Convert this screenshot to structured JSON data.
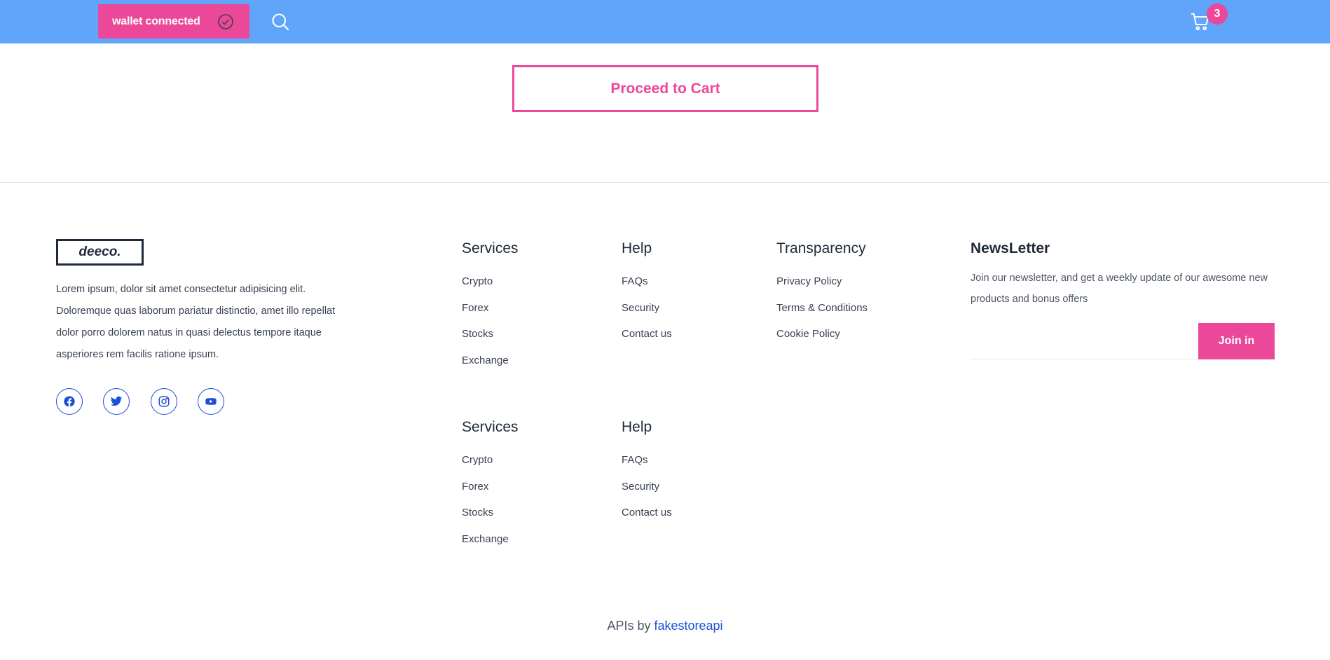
{
  "header": {
    "wallet_label": "wallet connected",
    "cart_count": "3"
  },
  "main": {
    "proceed_label": "Proceed to Cart"
  },
  "footer": {
    "logo_text": "deeco.",
    "about": "Lorem ipsum, dolor sit amet consectetur adipisicing elit. Doloremque quas laborum pariatur distinctio, amet illo repellat dolor porro dolorem natus in quasi delectus tempore itaque asperiores rem facilis ratione ipsum.",
    "social": [
      "facebook-icon",
      "twitter-icon",
      "instagram-icon",
      "youtube-icon"
    ],
    "columns": [
      {
        "title": "Services",
        "links": [
          "Crypto",
          "Forex",
          "Stocks",
          "Exchange"
        ]
      },
      {
        "title": "Help",
        "links": [
          "FAQs",
          "Security",
          "Contact us"
        ]
      },
      {
        "title": "Transparency",
        "links": [
          "Privacy Policy",
          "Terms & Conditions",
          "Cookie Policy"
        ]
      },
      {
        "title": "Services",
        "links": [
          "Crypto",
          "Forex",
          "Stocks",
          "Exchange"
        ]
      },
      {
        "title": "Help",
        "links": [
          "FAQs",
          "Security",
          "Contact us"
        ]
      }
    ],
    "newsletter": {
      "title": "NewsLetter",
      "text": "Join our newsletter, and get a weekly update of our awesome new products and bonus offers",
      "placeholder": "",
      "button": "Join in"
    },
    "credits_prefix": "APIs by",
    "credits_link": "fakestoreapi"
  },
  "colors": {
    "header_bg": "#60a5fa",
    "accent": "#ec4899",
    "link": "#1d4ed8"
  }
}
